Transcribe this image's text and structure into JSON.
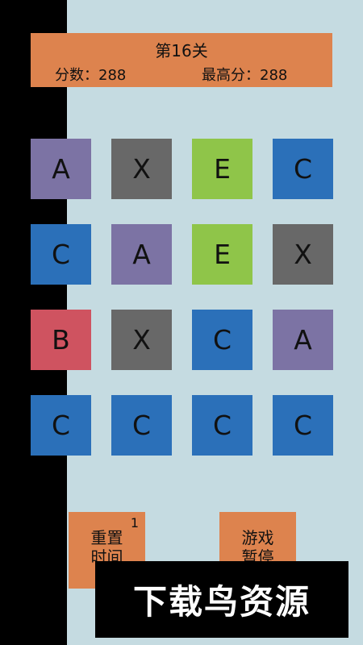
{
  "header": {
    "level": "第16关",
    "score": "分数：288",
    "best": "最高分：288"
  },
  "colors": {
    "A": "#7c73a4",
    "X": "#686868",
    "E": "#8fc549",
    "C": "#2b70b9",
    "B": "#cf5360"
  },
  "grid": [
    [
      "A",
      "X",
      "E",
      "C"
    ],
    [
      "C",
      "A",
      "E",
      "X"
    ],
    [
      "B",
      "X",
      "C",
      "A"
    ],
    [
      "C",
      "C",
      "C",
      "C"
    ]
  ],
  "buttons": {
    "reset_label": "重置\n时间",
    "reset_count": "1",
    "pause_label": "游戏\n暂停"
  },
  "watermark": "下载鸟资源"
}
